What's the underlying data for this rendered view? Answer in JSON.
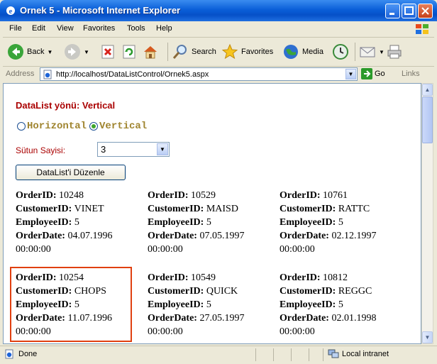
{
  "window": {
    "title": "Ornek 5 - Microsoft Internet Explorer"
  },
  "menu": [
    "File",
    "Edit",
    "View",
    "Favorites",
    "Tools",
    "Help"
  ],
  "toolbar": {
    "back": "Back",
    "search": "Search",
    "favorites": "Favorites",
    "media": "Media"
  },
  "address": {
    "label": "Address",
    "url": "http://localhost/DataListControl/Ornek5.aspx",
    "go": "Go",
    "links": "Links"
  },
  "page": {
    "heading": "DataList yönü: Vertical",
    "radio_horizontal": "Horizontal",
    "radio_vertical": "Vertical",
    "selected_direction": "Vertical",
    "column_label": "Sütun Sayisi:",
    "column_value": "3",
    "edit_button": "DataList'i Düzenle",
    "field_labels": {
      "order": "OrderID:",
      "customer": "CustomerID:",
      "employee": "EmployeeID:",
      "date": "OrderDate:"
    },
    "records": [
      {
        "order": "10248",
        "customer": "VINET",
        "employee": "5",
        "date": "04.07.1996",
        "time": "00:00:00"
      },
      {
        "order": "10529",
        "customer": "MAISD",
        "employee": "5",
        "date": "07.05.1997",
        "time": "00:00:00"
      },
      {
        "order": "10761",
        "customer": "RATTC",
        "employee": "5",
        "date": "02.12.1997",
        "time": "00:00:00"
      },
      {
        "order": "10254",
        "customer": "CHOPS",
        "employee": "5",
        "date": "11.07.1996",
        "time": "00:00:00"
      },
      {
        "order": "10549",
        "customer": "QUICK",
        "employee": "5",
        "date": "27.05.1997",
        "time": "00:00:00"
      },
      {
        "order": "10812",
        "customer": "REGGC",
        "employee": "5",
        "date": "02.01.1998",
        "time": "00:00:00"
      }
    ]
  },
  "status": {
    "text": "Done",
    "zone": "Local intranet"
  },
  "colors": {
    "heading": "#aa0000",
    "radio_text": "#a08530",
    "highlight": "#e04010"
  }
}
